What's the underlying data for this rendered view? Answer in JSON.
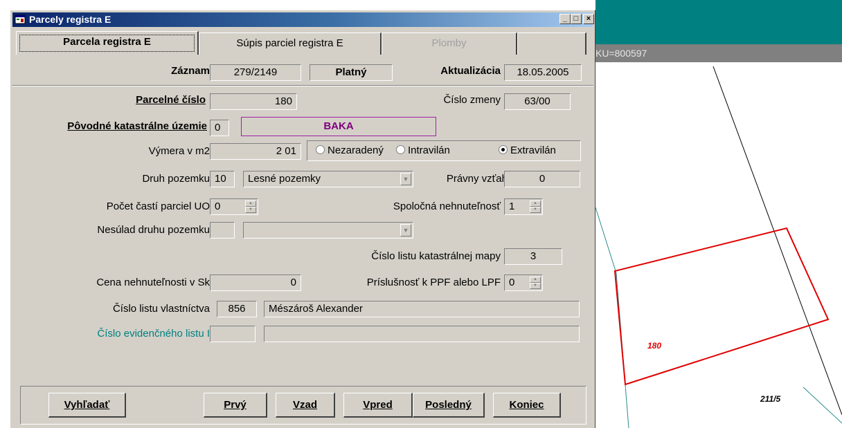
{
  "window": {
    "title": "Parcely registra E"
  },
  "tabs": [
    {
      "label": "Parcela registra E"
    },
    {
      "label": "Súpis parciel registra E"
    },
    {
      "label": "Plomby"
    }
  ],
  "header": {
    "zaznam_label": "Záznam",
    "zaznam_value": "279/2149",
    "status": "Platný",
    "aktualizacia_label": "Aktualizácia",
    "aktualizacia_value": "18.05.2005"
  },
  "form": {
    "parcelne_cislo_label": "Parcelné číslo",
    "parcelne_cislo_value": "180",
    "cislo_zmeny_label": "Číslo zmeny",
    "cislo_zmeny_value": "63/00",
    "povodne_ku_label": "Pôvodné katastrálne územie",
    "povodne_ku_code": "0",
    "povodne_ku_name": "BAKA",
    "vymera_label": "Výmera v m2",
    "vymera_value": "2 01",
    "radio_nezaradeny": "Nezaradený",
    "radio_intravilan": "Intravilán",
    "radio_extravilan": "Extravilán",
    "druh_label": "Druh pozemku",
    "druh_code": "10",
    "druh_name": "Lesné pozemky",
    "pravny_vztah_label": "Právny vzťah",
    "pravny_vztah_value": "0",
    "pocet_casti_label": "Počet častí parciel UO",
    "pocet_casti_value": "0",
    "spolocna_label": "Spoločná nehnuteľnosť",
    "spolocna_value": "1",
    "nesulad_label": "Nesúlad druhu pozemku",
    "nesulad_code": "",
    "nesulad_name": "",
    "cislo_listu_mapy_label": "Číslo listu katastrálnej mapy",
    "cislo_listu_mapy_value": "3",
    "cena_label": "Cena nehnuteľnosti v Sk",
    "cena_value": "0",
    "prislusnost_label": "Príslušnosť k PPF alebo LPF",
    "prislusnost_value": "0",
    "lv_label": "Číslo listu vlastníctva",
    "lv_value": "856",
    "lv_owner": "Mészároš Alexander",
    "evidencny_label": "Číslo evidenčného listu I",
    "evidencny_value": "",
    "evidencny_name": ""
  },
  "buttons": {
    "vyhladat": "Vyhľadať",
    "prvy": "Prvý",
    "vzad": "Vzad",
    "vpred": "Vpred",
    "posledny": "Posledný",
    "koniec": "Koniec"
  },
  "map": {
    "ku_text": "KU=800597",
    "parcel_label": "180",
    "parcel_label_2": "211/5",
    "parcel_color": "#e00000",
    "title_color": "#008080"
  }
}
